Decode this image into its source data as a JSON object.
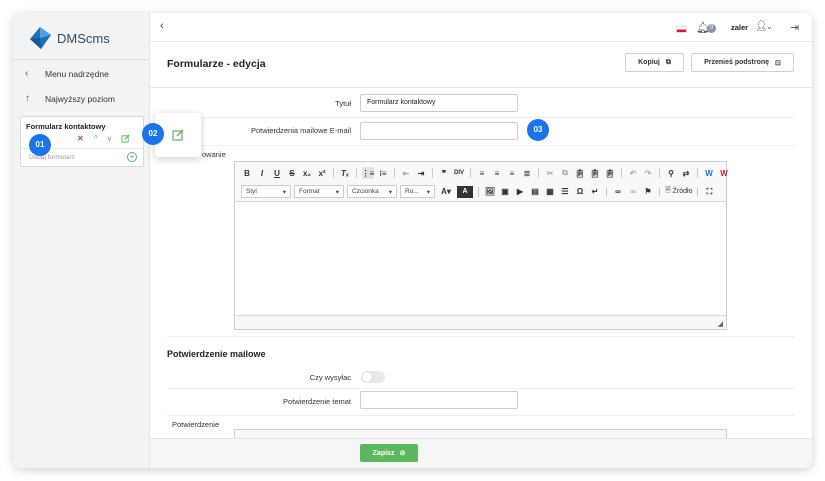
{
  "app": {
    "name": "DMScms"
  },
  "sidebar": {
    "menu_parent": "Menu nadrzędne",
    "top_level": "Najwyższy poziom",
    "tree_item": "Formularz kontaktowy",
    "tree_sub": "Dodaj formularz"
  },
  "badges": {
    "b1": "01",
    "b2": "02",
    "b3": "03"
  },
  "topbar": {
    "notifications": "0",
    "user": "zaler"
  },
  "page": {
    "title": "Formularze - edycja",
    "copy_btn": "Kopiuj",
    "move_btn": "Przenieś podstronę"
  },
  "form": {
    "title_label": "Tytuł",
    "title_value": "Formularz kontaktowy",
    "emails_label": "Potwierdzenia mailowe E-mail",
    "emails_value": "",
    "content_label": "owanie",
    "section_title": "Potwierdzenie mailowe",
    "send_label": "Czy wysyłac",
    "subject_label": "Potwierdzenie temat",
    "subject_value": "",
    "confirm_label": "Potwierdzenie"
  },
  "editor": {
    "style": "Styl",
    "format": "Format",
    "font": "Czcionka",
    "size": "Ro...",
    "source": "Źródło"
  },
  "footer": {
    "save": "Zapisz"
  },
  "colors": {
    "accent": "#1a73e8",
    "success": "#5cb85c",
    "danger": "#e53935"
  }
}
